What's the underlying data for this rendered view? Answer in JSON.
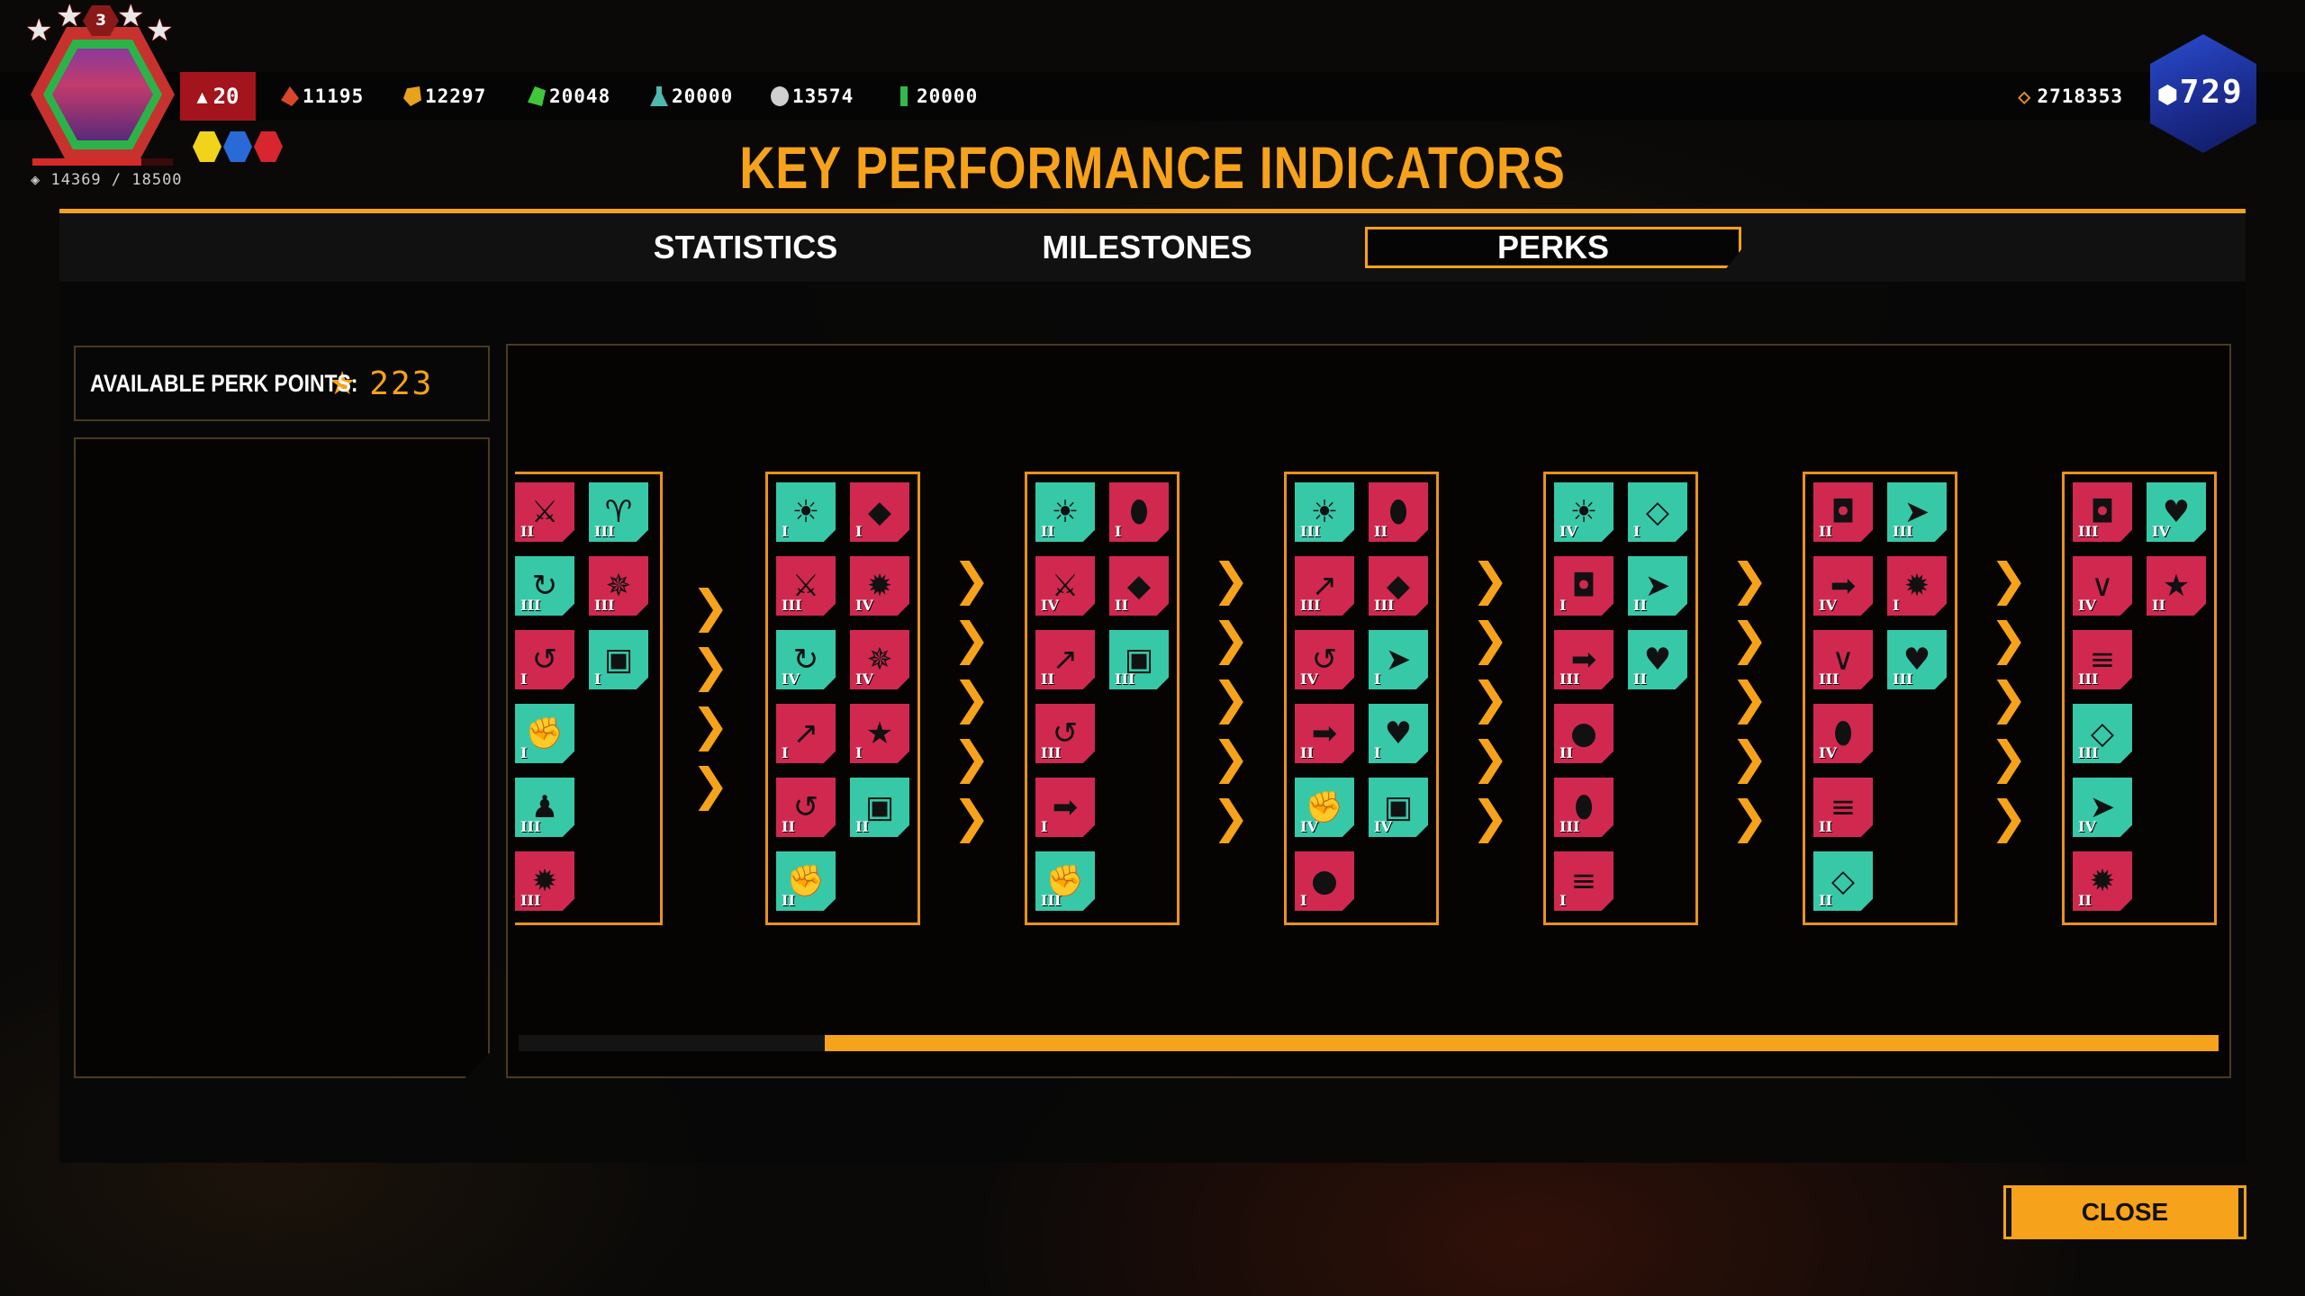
{
  "player": {
    "rank": "3",
    "level": "20",
    "xp": "14369 / 18500",
    "xp_fraction": 0.7767
  },
  "resources": [
    {
      "name": "red-resource-icon",
      "value": "11195",
      "color": "#d9462a"
    },
    {
      "name": "gold-resource-icon",
      "value": "12297",
      "color": "#e8a21c"
    },
    {
      "name": "green-resource-icon",
      "value": "20048",
      "color": "#3ec83a"
    },
    {
      "name": "teal-flask-icon",
      "value": "20000",
      "color": "#4fb8b0"
    },
    {
      "name": "silver-orb-icon",
      "value": "13574",
      "color": "#cfcfcf"
    },
    {
      "name": "green-vial-icon",
      "value": "20000",
      "color": "#35b84a"
    }
  ],
  "credits": "2718353",
  "premium": "729",
  "title": "KEY PERFORMANCE INDICATORS",
  "tabs": {
    "statistics": "STATISTICS",
    "milestones": "MILESTONES",
    "perks": "PERKS",
    "active": "perks"
  },
  "perk_points": {
    "label": "AVAILABLE PERK POINTS:",
    "value": "223"
  },
  "close_label": "CLOSE",
  "colors": {
    "accent": "#f7a21b",
    "teal": "#37c8a8",
    "red": "#d1284f"
  },
  "columns": [
    {
      "perks": [
        {
          "color": "red",
          "icon": "slash",
          "rank": "II"
        },
        {
          "color": "teal",
          "icon": "horns",
          "rank": "III"
        },
        {
          "color": "teal",
          "icon": "cycle-cross",
          "rank": "III"
        },
        {
          "color": "red",
          "icon": "spiral-burst",
          "rank": "III"
        },
        {
          "color": "red",
          "icon": "cycle-arrows",
          "rank": "I"
        },
        {
          "color": "teal",
          "icon": "boot",
          "rank": "I"
        },
        {
          "color": "teal",
          "icon": "fist",
          "rank": "I"
        },
        {
          "color": "teal",
          "icon": "crowd",
          "rank": "III"
        },
        {
          "color": "red",
          "icon": "explosion",
          "rank": "III"
        }
      ]
    },
    {
      "perks": [
        {
          "color": "teal",
          "icon": "sun-burst",
          "rank": "I"
        },
        {
          "color": "red",
          "icon": "shield",
          "rank": "I"
        },
        {
          "color": "red",
          "icon": "slash",
          "rank": "III"
        },
        {
          "color": "red",
          "icon": "explosion",
          "rank": "IV"
        },
        {
          "color": "teal",
          "icon": "cycle-cross",
          "rank": "IV"
        },
        {
          "color": "red",
          "icon": "spiral-burst",
          "rank": "IV"
        },
        {
          "color": "red",
          "icon": "arrow-up-leaf",
          "rank": "I"
        },
        {
          "color": "red",
          "icon": "star",
          "rank": "I"
        },
        {
          "color": "red",
          "icon": "cycle-arrows",
          "rank": "II"
        },
        {
          "color": "teal",
          "icon": "boot",
          "rank": "II"
        },
        {
          "color": "teal",
          "icon": "fist",
          "rank": "II"
        }
      ]
    },
    {
      "perks": [
        {
          "color": "teal",
          "icon": "sun-burst",
          "rank": "II"
        },
        {
          "color": "red",
          "icon": "muscle",
          "rank": "I"
        },
        {
          "color": "red",
          "icon": "slash",
          "rank": "IV"
        },
        {
          "color": "red",
          "icon": "shield",
          "rank": "II"
        },
        {
          "color": "red",
          "icon": "arrow-up-leaf",
          "rank": "II"
        },
        {
          "color": "teal",
          "icon": "boot",
          "rank": "III"
        },
        {
          "color": "red",
          "icon": "cycle-arrows",
          "rank": "III"
        },
        {
          "color": "red",
          "icon": "arrow-right",
          "rank": "I"
        },
        {
          "color": "teal",
          "icon": "fist",
          "rank": "III"
        }
      ]
    },
    {
      "perks": [
        {
          "color": "teal",
          "icon": "sun-burst",
          "rank": "III"
        },
        {
          "color": "red",
          "icon": "muscle",
          "rank": "II"
        },
        {
          "color": "red",
          "icon": "arrow-up-leaf",
          "rank": "III"
        },
        {
          "color": "red",
          "icon": "shield",
          "rank": "III"
        },
        {
          "color": "red",
          "icon": "cycle-arrows",
          "rank": "IV"
        },
        {
          "color": "teal",
          "icon": "dash-arrow",
          "rank": "I"
        },
        {
          "color": "red",
          "icon": "arrow-right",
          "rank": "II"
        },
        {
          "color": "teal",
          "icon": "heart-runner",
          "rank": "I"
        },
        {
          "color": "teal",
          "icon": "fist",
          "rank": "IV"
        },
        {
          "color": "teal",
          "icon": "boot",
          "rank": "IV"
        },
        {
          "color": "red",
          "icon": "blood-drop",
          "rank": "I"
        }
      ]
    },
    {
      "perks": [
        {
          "color": "teal",
          "icon": "sun-burst",
          "rank": "IV"
        },
        {
          "color": "teal",
          "icon": "shield-slash",
          "rank": "I"
        },
        {
          "color": "red",
          "icon": "pouch",
          "rank": "I"
        },
        {
          "color": "teal",
          "icon": "dash-arrow",
          "rank": "II"
        },
        {
          "color": "red",
          "icon": "arrow-right",
          "rank": "III"
        },
        {
          "color": "teal",
          "icon": "heart-runner",
          "rank": "II"
        },
        {
          "color": "red",
          "icon": "blood-drop",
          "rank": "II"
        },
        {
          "color": "red",
          "icon": "muscle",
          "rank": "III"
        },
        {
          "color": "red",
          "icon": "claw",
          "rank": "I"
        }
      ]
    },
    {
      "perks": [
        {
          "color": "red",
          "icon": "pouch",
          "rank": "II"
        },
        {
          "color": "teal",
          "icon": "dash-arrow",
          "rank": "III"
        },
        {
          "color": "red",
          "icon": "arrow-right",
          "rank": "IV"
        },
        {
          "color": "red",
          "icon": "explosion",
          "rank": "I"
        },
        {
          "color": "red",
          "icon": "fangs",
          "rank": "III"
        },
        {
          "color": "teal",
          "icon": "heart-runner",
          "rank": "III"
        },
        {
          "color": "red",
          "icon": "muscle",
          "rank": "IV"
        },
        {
          "color": "red",
          "icon": "claw",
          "rank": "II"
        },
        {
          "color": "teal",
          "icon": "shield-slash",
          "rank": "II"
        }
      ]
    },
    {
      "perks": [
        {
          "color": "red",
          "icon": "pouch",
          "rank": "III"
        },
        {
          "color": "teal",
          "icon": "heart-runner",
          "rank": "IV"
        },
        {
          "color": "red",
          "icon": "fangs",
          "rank": "IV"
        },
        {
          "color": "red",
          "icon": "star",
          "rank": "II"
        },
        {
          "color": "red",
          "icon": "claw",
          "rank": "III"
        },
        {
          "color": "teal",
          "icon": "shield-slash",
          "rank": "III"
        },
        {
          "color": "teal",
          "icon": "dash-arrow",
          "rank": "IV"
        },
        {
          "color": "red",
          "icon": "explosion",
          "rank": "II"
        }
      ]
    }
  ],
  "scroll_fraction": 0.82
}
